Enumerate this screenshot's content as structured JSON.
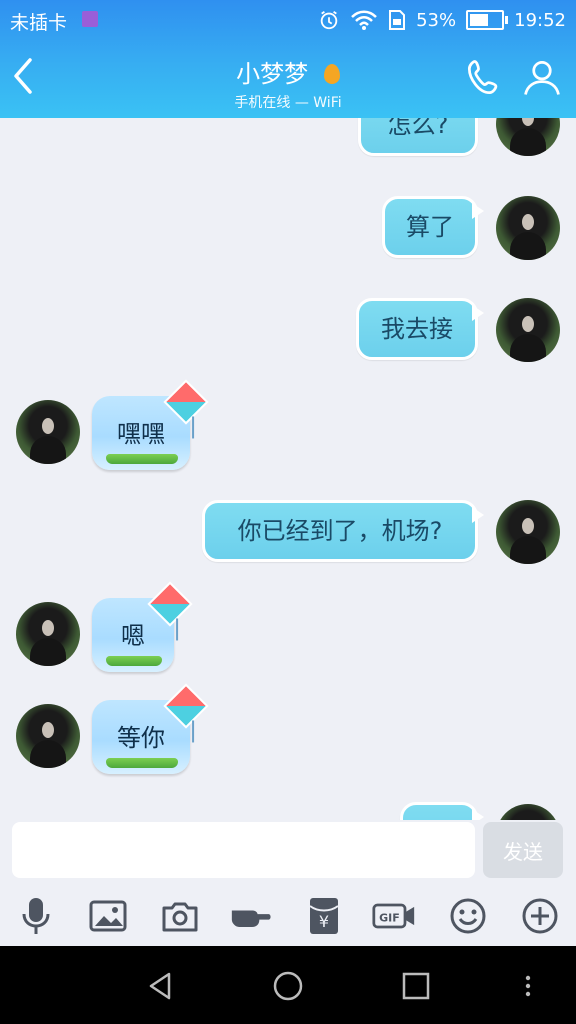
{
  "status_bar": {
    "carrier": "未插卡",
    "battery_percent": "53%",
    "time": "19:52",
    "icons": [
      "alarm-icon",
      "wifi-icon",
      "sim-icon",
      "battery-icon"
    ]
  },
  "header": {
    "title": "小梦梦",
    "subtitle": "手机在线 — WiFi",
    "back_icon": "back-arrow-icon",
    "call_icon": "phone-icon",
    "profile_icon": "profile-icon"
  },
  "messages": [
    {
      "from": "me",
      "text": "怎么?"
    },
    {
      "from": "me",
      "text": "算了"
    },
    {
      "from": "me",
      "text": "我去接"
    },
    {
      "from": "them",
      "text": "嘿嘿"
    },
    {
      "from": "me",
      "text": "你已经到了，机场?"
    },
    {
      "from": "them",
      "text": "嗯"
    },
    {
      "from": "them",
      "text": "等你"
    },
    {
      "from": "me",
      "text": ""
    }
  ],
  "composer": {
    "placeholder": "",
    "send_label": "发送"
  },
  "toolbar": [
    "microphone-icon",
    "image-icon",
    "camera-icon",
    "poke-icon",
    "red-packet-icon",
    "gif-icon",
    "emoji-icon",
    "plus-icon"
  ],
  "colors": {
    "header_top": "#2f90f0",
    "header_bottom": "#3ac2f4",
    "chat_bg": "#eef0f6",
    "bubble_out": "#7fdcf1",
    "bubble_in": "#bfe6ff"
  }
}
